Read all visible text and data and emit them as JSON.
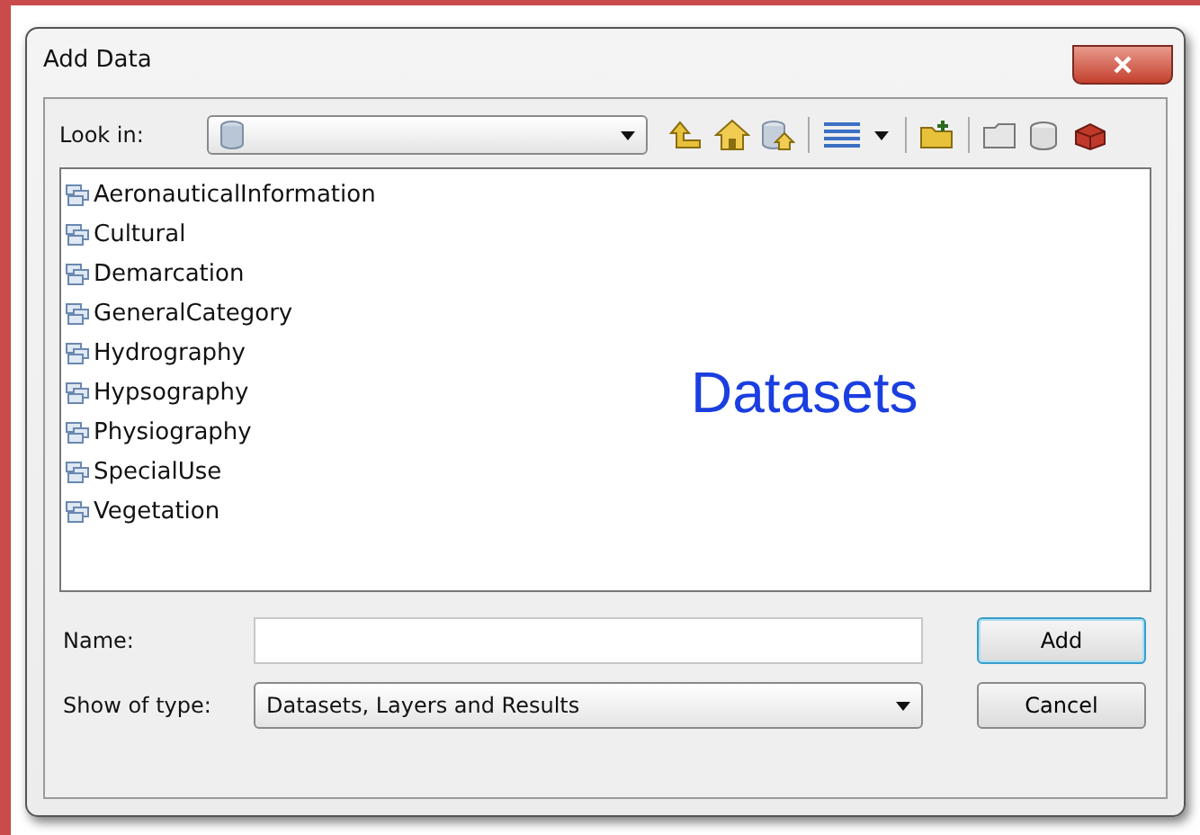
{
  "window": {
    "title": "Add Data"
  },
  "look_in": {
    "label": "Look in:"
  },
  "items": [
    {
      "name": "AeronauticalInformation"
    },
    {
      "name": "Cultural"
    },
    {
      "name": "Demarcation"
    },
    {
      "name": "GeneralCategory"
    },
    {
      "name": "Hydrography"
    },
    {
      "name": "Hypsography"
    },
    {
      "name": "Physiography"
    },
    {
      "name": "SpecialUse"
    },
    {
      "name": "Vegetation"
    }
  ],
  "overlay_label": "Datasets",
  "name_field": {
    "label": "Name:"
  },
  "type_field": {
    "label": "Show of type:",
    "value": "Datasets, Layers and Results"
  },
  "buttons": [
    {
      "label": "Add",
      "default": true
    },
    {
      "label": "Cancel",
      "default": false
    }
  ]
}
